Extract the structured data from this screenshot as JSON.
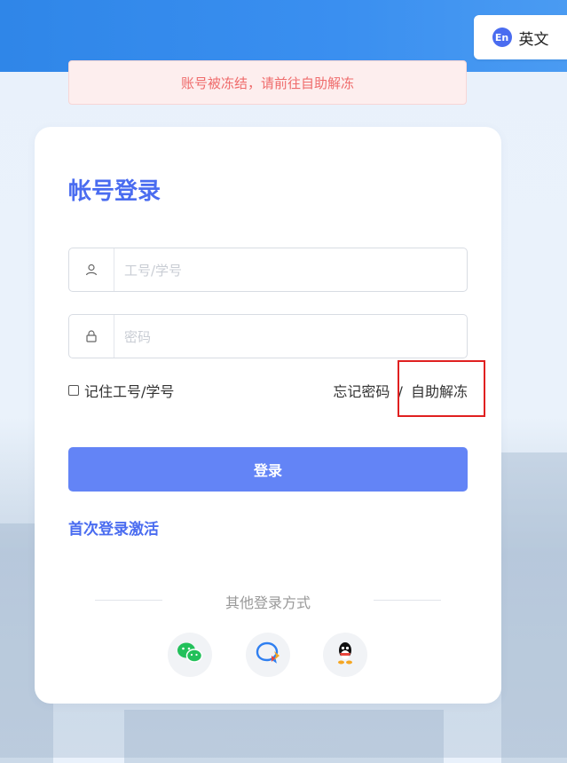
{
  "lang": {
    "icon": "en-language-icon",
    "icon_text": "En",
    "label": "英文"
  },
  "alert": {
    "text": "账号被冻结，请前往自助解冻"
  },
  "login": {
    "title": "帐号登录",
    "username": {
      "value": "",
      "placeholder": "工号/学号"
    },
    "password": {
      "value": "",
      "placeholder": "密码"
    },
    "remember_label": "记住工号/学号",
    "forgot_label": "忘记密码",
    "separator": "/",
    "unfreeze_label": "自助解冻",
    "submit_label": "登录",
    "activate_label": "首次登录激活",
    "other_methods_label": "其他登录方式"
  },
  "social": [
    {
      "name": "wechat-icon",
      "color": "#22c05a"
    },
    {
      "name": "dingtalk-icon",
      "color": "#2f7ff0"
    },
    {
      "name": "qq-icon",
      "color": "#111111"
    }
  ],
  "colors": {
    "accent": "#4a6cf0",
    "button": "#6384f6",
    "alert_text": "#ef6b6b",
    "highlight": "#e02020"
  }
}
